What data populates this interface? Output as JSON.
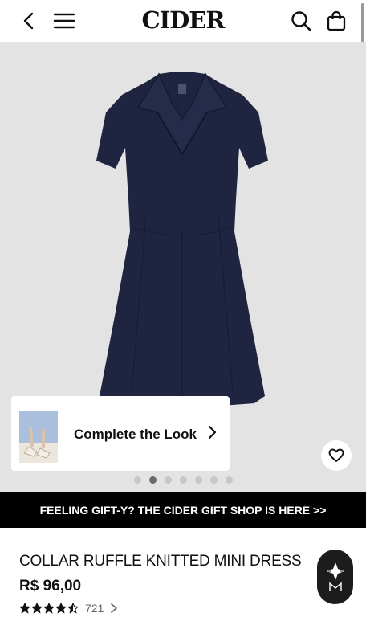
{
  "header": {
    "logo": "CIDER",
    "icons": [
      "back-icon",
      "menu-icon",
      "search-icon",
      "bag-icon"
    ]
  },
  "gallery": {
    "complete_look_label": "Complete the Look",
    "dots_total": 7,
    "active_dot": 2
  },
  "banner": {
    "text": "FEELING GIFT-Y? THE CIDER GIFT SHOP IS HERE >>"
  },
  "product": {
    "title": "COLLAR RUFFLE KNITTED MINI DRESS",
    "price": "R$ 96,00",
    "rating_value": 4.5,
    "review_count": "721"
  },
  "colors": {
    "dress": "#1f2540",
    "banner_bg": "#000000",
    "gallery_bg": "#e3e3e3"
  }
}
